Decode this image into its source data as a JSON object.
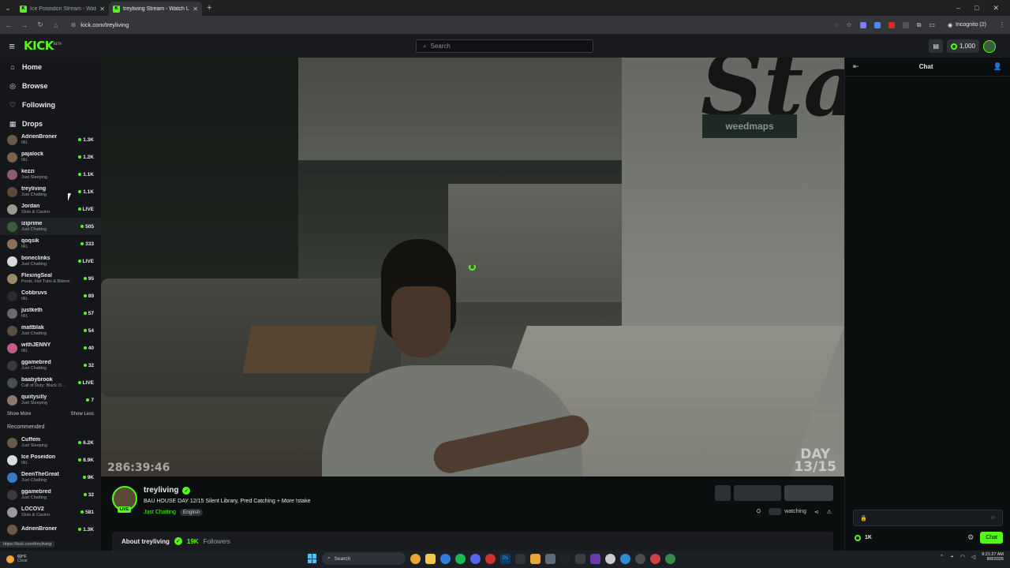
{
  "browser": {
    "tabs": [
      {
        "title": "Ice Poseidon Stream - Watch Live",
        "active": false
      },
      {
        "title": "treyliving Stream - Watch Live",
        "active": true
      }
    ],
    "new_tab": "+",
    "url": "kick.com/treyliving",
    "profile": "Incognito (2)",
    "window_controls": [
      "–",
      "□",
      "✕"
    ]
  },
  "header": {
    "logo": "KICK",
    "logo_badge": "BETA",
    "search_placeholder": "Search",
    "points": "1,000"
  },
  "nav": [
    {
      "label": "Home",
      "icon": "home-icon"
    },
    {
      "label": "Browse",
      "icon": "compass-icon"
    },
    {
      "label": "Following",
      "icon": "heart-icon"
    },
    {
      "label": "Drops",
      "icon": "gift-icon"
    }
  ],
  "following": [
    {
      "name": "AdrienBroner",
      "category": "IRL",
      "viewers": "1.3K",
      "color": "#6b5a4a"
    },
    {
      "name": "pajalock",
      "category": "IRL",
      "viewers": "1.2K",
      "color": "#7a6250"
    },
    {
      "name": "kezzi",
      "category": "Just Sleeping",
      "viewers": "1.1K",
      "color": "#8a5e6e"
    },
    {
      "name": "treyliving",
      "category": "Just Chatting",
      "viewers": "1.1K",
      "color": "#5a4a36"
    },
    {
      "name": "Jordan",
      "category": "Slots & Casino",
      "viewers": "LIVE",
      "color": "#9a9a92"
    },
    {
      "name": "iziprime",
      "category": "Just Chatting",
      "viewers": "505",
      "color": "#3e5a3a",
      "highlight": true
    },
    {
      "name": "qoqsik",
      "category": "IRL",
      "viewers": "333",
      "color": "#8a6e5e"
    },
    {
      "name": "boneclinks",
      "category": "Just Chatting",
      "viewers": "LIVE",
      "color": "#d8d8d8"
    },
    {
      "name": "FlexingSeal",
      "category": "Pools, Hot Tubs & Bikinis",
      "viewers": "95",
      "color": "#9a8a6a"
    },
    {
      "name": "Cobbruvs",
      "category": "IRL",
      "viewers": "89",
      "color": "#2a2c30"
    },
    {
      "name": "justketh",
      "category": "IRL",
      "viewers": "57",
      "color": "#6a6a6a"
    },
    {
      "name": "mattblak",
      "category": "Just Chatting",
      "viewers": "54",
      "color": "#5a5040"
    },
    {
      "name": "withJENNY",
      "category": "IRL",
      "viewers": "40",
      "color": "#c45a8a"
    },
    {
      "name": "ggamebred",
      "category": "Just Chatting",
      "viewers": "32",
      "color": "#3a3a3a"
    },
    {
      "name": "baabybrook",
      "category": "Call of Duty: Black O...",
      "viewers": "LIVE",
      "color": "#4a4e54"
    },
    {
      "name": "quiitysilly",
      "category": "Just Sleeping",
      "viewers": "7",
      "color": "#8a7a6a"
    }
  ],
  "show_more": "Show More",
  "show_less": "Show Less",
  "recommended_title": "Recommended",
  "recommended": [
    {
      "name": "Cuffem",
      "category": "Just Sleeping",
      "viewers": "6.2K",
      "color": "#6a5a4a"
    },
    {
      "name": "Ice Poseidon",
      "category": "IRL",
      "viewers": "8.9K",
      "color": "#d8dce0"
    },
    {
      "name": "DeenTheGreat",
      "category": "Just Chatting",
      "viewers": "9K",
      "color": "#3a7ac4"
    },
    {
      "name": "ggamebred",
      "category": "Just Chatting",
      "viewers": "32",
      "color": "#3a3a3a"
    },
    {
      "name": "LOCOV2",
      "category": "Slots & Casino",
      "viewers": "581",
      "color": "#9a9a9a"
    },
    {
      "name": "AdrienBroner",
      "category": "",
      "viewers": "1.3K",
      "color": "#6b5a4a"
    }
  ],
  "video": {
    "uptime": "286:39:46",
    "day_line1": "DAY",
    "day_line2": "13/15",
    "sign_text": "weedmaps",
    "wall_text": "Stak"
  },
  "stream": {
    "streamer": "treyliving",
    "live_label": "LIVE",
    "title": "BAU HOUSE DAY 12/15 Silent Library, Pred Catching + More !stake",
    "category": "Just Chatting",
    "language": "English",
    "watching_label": "watching"
  },
  "about": {
    "label": "About treyliving",
    "followers_count": "19K",
    "followers_label": "Followers"
  },
  "status_url": "https://kick.com/treyliving",
  "chat": {
    "title": "Chat",
    "points": "1K",
    "send_label": "Chat"
  },
  "taskbar": {
    "temp": "69°F",
    "condition": "Clear",
    "search_placeholder": "Search",
    "time": "9:21:27 AM",
    "date": "8/8/2026"
  },
  "colors": {
    "accent": "#53fc18",
    "bg": "#0b0e0f",
    "panel": "#191b1f"
  }
}
